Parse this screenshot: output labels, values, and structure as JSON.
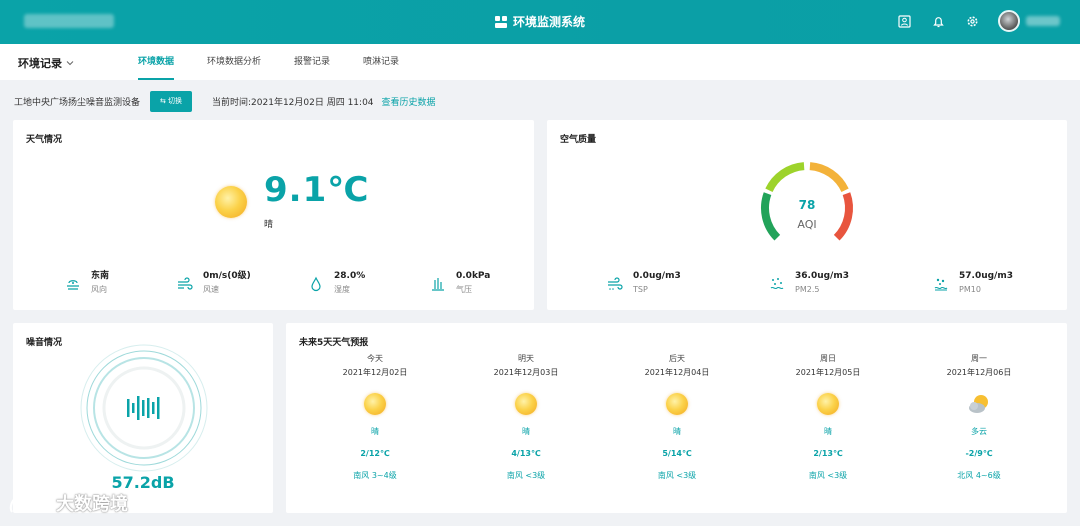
{
  "header": {
    "system_title": "环境监测系统"
  },
  "nav": {
    "section_title": "环境记录",
    "tabs": [
      {
        "label": "环境数据"
      },
      {
        "label": "环境数据分析"
      },
      {
        "label": "报警记录"
      },
      {
        "label": "喷淋记录"
      }
    ]
  },
  "device": {
    "name": "工地中央广场扬尘噪音监测设备",
    "switch_label": "⇆ 切换",
    "current_time": "当前时间:2021年12月02日 周四 11:04",
    "history_link": "查看历史数据"
  },
  "weather": {
    "title": "天气情况",
    "temperature": "9.1℃",
    "condition": "晴",
    "icon": "sunny-icon",
    "metrics": [
      {
        "value": "东南",
        "label": "风向",
        "icon": "wind-direction-icon"
      },
      {
        "value": "0m/s(0级)",
        "label": "风速",
        "icon": "wind-speed-icon"
      },
      {
        "value": "28.0%",
        "label": "湿度",
        "icon": "humidity-icon"
      },
      {
        "value": "0.0kPa",
        "label": "气压",
        "icon": "pressure-icon"
      }
    ]
  },
  "air": {
    "title": "空气质量",
    "aqi_value": "78",
    "aqi_label": "AQI",
    "gauge_colors": [
      "#22a35a",
      "#9dd32b",
      "#f3b23a",
      "#e8553e"
    ],
    "metrics": [
      {
        "value": "0.0ug/m3",
        "label": "TSP",
        "icon": "tsp-icon"
      },
      {
        "value": "36.0ug/m3",
        "label": "PM2.5",
        "icon": "pm25-icon"
      },
      {
        "value": "57.0ug/m3",
        "label": "PM10",
        "icon": "pm10-icon"
      }
    ]
  },
  "noise": {
    "title": "噪音情况",
    "value": "57.2dB"
  },
  "forecast": {
    "title": "未来5天天气预报",
    "days": [
      {
        "day": "今天",
        "date": "2021年12月02日",
        "weather": "晴",
        "temp": "2/12℃",
        "wind": "南风 3~4级",
        "icon": "sunny-icon"
      },
      {
        "day": "明天",
        "date": "2021年12月03日",
        "weather": "晴",
        "temp": "4/13℃",
        "wind": "南风 <3级",
        "icon": "sunny-icon"
      },
      {
        "day": "后天",
        "date": "2021年12月04日",
        "weather": "晴",
        "temp": "5/14℃",
        "wind": "南风 <3级",
        "icon": "sunny-icon"
      },
      {
        "day": "周日",
        "date": "2021年12月05日",
        "weather": "晴",
        "temp": "2/13℃",
        "wind": "南风 <3级",
        "icon": "sunny-icon"
      },
      {
        "day": "周一",
        "date": "2021年12月06日",
        "weather": "多云",
        "temp": "-2/9℃",
        "wind": "北风 4~6级",
        "icon": "cloudy-icon"
      }
    ]
  },
  "watermark": {
    "text": "大数跨境"
  },
  "colors": {
    "accent": "#0aa3a8"
  }
}
